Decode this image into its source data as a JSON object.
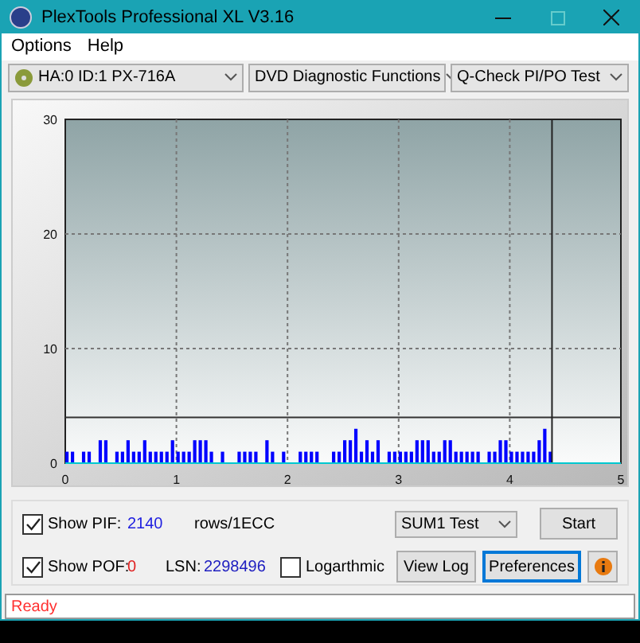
{
  "window": {
    "title": "PlexTools Professional XL V3.16"
  },
  "menu": [
    {
      "label": "Options"
    },
    {
      "label": "Help"
    }
  ],
  "toolbar": [
    {
      "kind": "drive",
      "value": "HA:0 ID:1  PX-716A"
    },
    {
      "kind": "plain",
      "value": "DVD Diagnostic Functions"
    },
    {
      "kind": "plain",
      "value": "Q-Check PI/PO Test"
    }
  ],
  "chart_data": {
    "type": "bar",
    "grid": true,
    "xlim": [
      0,
      5
    ],
    "ylim": [
      0,
      30
    ],
    "xticks": [
      0,
      1,
      2,
      3,
      4,
      5
    ],
    "yticks": [
      0,
      10,
      20,
      30
    ],
    "x": [
      0,
      0.05,
      0.15,
      0.2,
      0.3,
      0.35,
      0.45,
      0.5,
      0.55,
      0.6,
      0.65,
      0.7,
      0.75,
      0.8,
      0.85,
      0.9,
      0.95,
      1,
      1.05,
      1.1,
      1.15,
      1.2,
      1.25,
      1.3,
      1.4,
      1.55,
      1.6,
      1.65,
      1.7,
      1.8,
      1.85,
      1.95,
      2.1,
      2.15,
      2.2,
      2.25,
      2.4,
      2.45,
      2.5,
      2.55,
      2.6,
      2.65,
      2.7,
      2.75,
      2.8,
      2.9,
      2.95,
      3,
      3.05,
      3.1,
      3.15,
      3.2,
      3.25,
      3.3,
      3.35,
      3.4,
      3.45,
      3.5,
      3.55,
      3.6,
      3.65,
      3.7,
      3.8,
      3.85,
      3.9,
      3.95,
      4,
      4.05,
      4.1,
      4.15,
      4.2,
      4.25,
      4.3,
      4.35
    ],
    "series": [
      {
        "color": "#0000ff",
        "values": [
          1,
          1,
          1,
          1,
          2,
          2,
          1,
          1,
          2,
          1,
          1,
          2,
          1,
          1,
          1,
          1,
          2,
          1,
          1,
          1,
          2,
          2,
          2,
          1,
          1,
          1,
          1,
          1,
          1,
          2,
          1,
          1,
          1,
          1,
          1,
          1,
          1,
          1,
          2,
          2,
          3,
          1,
          2,
          1,
          2,
          1,
          1,
          1,
          1,
          1,
          2,
          2,
          2,
          1,
          1,
          2,
          2,
          1,
          1,
          1,
          1,
          1,
          1,
          1,
          2,
          2,
          1,
          1,
          1,
          1,
          1,
          2,
          3,
          1
        ]
      }
    ],
    "ref_lines": [
      {
        "axis": "y",
        "value": 4
      },
      {
        "axis": "x",
        "value": 4.38
      }
    ]
  },
  "controls": {
    "pif": {
      "label": "Show PIF:",
      "checked": true,
      "value": "2140",
      "unit": "rows/1ECC"
    },
    "pof": {
      "label": "Show POF:",
      "checked": true,
      "value": "0"
    },
    "lsn": {
      "label": "LSN:",
      "value": "2298496"
    },
    "logarithmic": {
      "label": "Logarthmic",
      "checked": false
    },
    "test": {
      "value": "SUM1 Test"
    },
    "buttons": [
      {
        "kind": "text",
        "label": "Start",
        "focused": false
      },
      {
        "kind": "text",
        "label": "View Log",
        "focused": false
      },
      {
        "kind": "text",
        "label": "Preferences",
        "focused": true
      },
      {
        "kind": "info",
        "focused": false
      }
    ]
  },
  "status_bar": {
    "text": "Ready"
  }
}
